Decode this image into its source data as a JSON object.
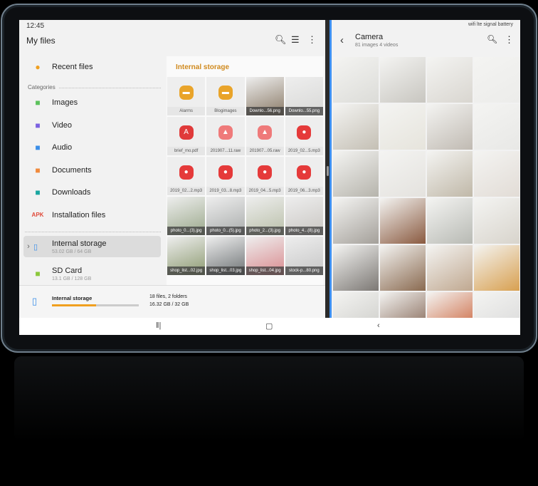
{
  "status_bar": {
    "time": "12:45",
    "right_icons": "wifi lte signal battery"
  },
  "left_pane": {
    "title": "My files",
    "header_icons": [
      "search-icon",
      "list-view-icon",
      "more-icon"
    ],
    "recent": "Recent files",
    "categories_label": "Categories",
    "categories": [
      {
        "label": "Images",
        "icon": "image-icon",
        "color": "#5cc25c"
      },
      {
        "label": "Video",
        "icon": "video-icon",
        "color": "#7b61e0"
      },
      {
        "label": "Audio",
        "icon": "audio-icon",
        "color": "#3a8ee8"
      },
      {
        "label": "Documents",
        "icon": "document-icon",
        "color": "#f08a3c"
      },
      {
        "label": "Downloads",
        "icon": "download-icon",
        "color": "#1aa6a0"
      },
      {
        "label": "Installation files",
        "icon": "apk-icon",
        "icon_text": "APK",
        "color": "#e04a3a"
      }
    ],
    "storage": [
      {
        "label": "Internal storage",
        "detail": "53.02 GB / 64 GB",
        "selected": true
      },
      {
        "label": "SD Card",
        "detail": "13.1 GB / 128 GB"
      }
    ],
    "content": {
      "title": "Internal storage",
      "items": [
        {
          "label": "Alarms",
          "type": "folder"
        },
        {
          "label": "Blogimages",
          "type": "folder"
        },
        {
          "label": "Downlo...56.png",
          "type": "photo",
          "color": "#8a7a66"
        },
        {
          "label": "Downlo...55.png",
          "type": "photo",
          "color": "#d8d8d6"
        },
        {
          "label": "brief_mo.pdf",
          "type": "pdf"
        },
        {
          "label": "201907...11.raw",
          "type": "raw"
        },
        {
          "label": "201907...05.raw",
          "type": "raw"
        },
        {
          "label": "2019_02...5.mp3",
          "type": "audio"
        },
        {
          "label": "2019_02...2.mp3",
          "type": "audio"
        },
        {
          "label": "2019_03...8.mp3",
          "type": "audio"
        },
        {
          "label": "2019_04...5.mp3",
          "type": "audio"
        },
        {
          "label": "2019_06...3.mp3",
          "type": "audio"
        },
        {
          "label": "photo_0...(3).jpg",
          "type": "photo",
          "color": "#9aa88a"
        },
        {
          "label": "photo_0...(5).jpg",
          "type": "photo",
          "color": "#a9acab"
        },
        {
          "label": "photo_2...(3).jpg",
          "type": "photo",
          "color": "#b9bfa8"
        },
        {
          "label": "photo_4...(8).jpg",
          "type": "photo",
          "color": "#c9c6c2"
        },
        {
          "label": "shop_list...02.jpg",
          "type": "photo",
          "color": "#8c9a70"
        },
        {
          "label": "shop_list...03.jpg",
          "type": "photo",
          "color": "#6e7375"
        },
        {
          "label": "shop_list...04.jpg",
          "type": "photo",
          "color": "#d98a8e"
        },
        {
          "label": "stock-p...80.png",
          "type": "photo",
          "color": "#c6c6c6"
        }
      ]
    },
    "bottom": {
      "label": "Internal storage",
      "usage_percent": 51,
      "files": "18 files, 2 folders",
      "size": "16.32 GB / 32 GB"
    }
  },
  "right_pane": {
    "title": "Camera",
    "subtitle": "81 images 4 videos",
    "photos": [
      "#dcdcd8",
      "#c8c6c0",
      "#d9d6d0",
      "#ececea",
      "#c4bfb4",
      "#e6e4dc",
      "#c0bab2",
      "#e8e8e6",
      "#b6b4ac",
      "#e4e2de",
      "#c0b8a8",
      "#e2dcd6",
      "#a4a09a",
      "#8a5a40",
      "#b8bab4",
      "#d8d4cc",
      "#7c7874",
      "#8a6a50",
      "#c0a890",
      "#d8a050",
      "#cacac6",
      "#7a5a48",
      "#c85a30",
      "#d8d8d8"
    ]
  },
  "nav_bar": {
    "recents": "recents-icon",
    "home": "home-icon",
    "back": "back-icon"
  }
}
